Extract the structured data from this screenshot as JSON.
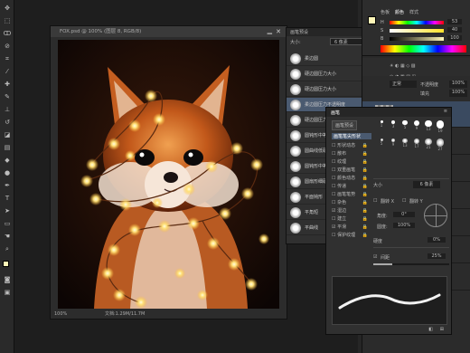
{
  "document": {
    "title": "FOX.psd @ 100% (图层 8, RGB/8)",
    "zoom": "100%",
    "doc_info": "文档:1.29M/11.7M"
  },
  "presets_panel": {
    "title": "画笔预设",
    "size_label": "大小:",
    "size_value": "6 像素",
    "items": [
      {
        "label": "柔边圆"
      },
      {
        "label": "硬边圆压力大小"
      },
      {
        "label": "硬边圆压力大小"
      },
      {
        "label": "柔边圆压力不透明度"
      },
      {
        "label": "硬边圆压力不透明度"
      },
      {
        "label": "圆钝形中等硬"
      },
      {
        "label": "圆曲线低硬毛刷百分比"
      },
      {
        "label": "圆钝形中等硬度"
      },
      {
        "label": "圆扇形细硬毛刷"
      },
      {
        "label": "平面钝形"
      },
      {
        "label": "平角短"
      },
      {
        "label": "平曲线"
      }
    ]
  },
  "brush_panel": {
    "title": "画笔",
    "preset_button": "画笔预设",
    "section_title": "画笔笔尖形状",
    "options": [
      {
        "label": "形状动态"
      },
      {
        "label": "散布"
      },
      {
        "label": "纹理"
      },
      {
        "label": "双重画笔"
      },
      {
        "label": "颜色动态"
      },
      {
        "label": "传递"
      },
      {
        "label": "画笔笔势"
      },
      {
        "label": "杂色"
      },
      {
        "label": "湿边"
      },
      {
        "label": "建立"
      },
      {
        "label": "平滑"
      },
      {
        "label": "保护纹理"
      }
    ],
    "tips": [
      {
        "num": "1"
      },
      {
        "num": "3"
      },
      {
        "num": "5"
      },
      {
        "num": "9"
      },
      {
        "num": "13"
      },
      {
        "num": "19"
      },
      {
        "num": "5"
      },
      {
        "num": "9"
      },
      {
        "num": "13"
      },
      {
        "num": "17"
      },
      {
        "num": "21"
      },
      {
        "num": "27"
      }
    ],
    "size_label": "大小",
    "size_value": "6 像素",
    "flipx_label": "翻转 X",
    "flipy_label": "翻转 Y",
    "angle_label": "角度:",
    "angle_value": "0°",
    "roundness_label": "圆度:",
    "roundness_value": "100%",
    "hardness_label": "硬度",
    "hardness_value": "0%",
    "spacing_label": "间距",
    "spacing_value": "25%"
  },
  "color_panel": {
    "tab_color": "颜色",
    "tab_swatches": "色板",
    "tab_styles": "样式",
    "h_label": "H",
    "h_value": "53",
    "s_label": "S",
    "s_value": "40",
    "b_label": "B",
    "b_value": "100"
  },
  "layers": {
    "blend_mode": "正常",
    "opacity_label": "不透明度",
    "opacity_value": "100%",
    "fill_label": "填充",
    "fill_value": "100%",
    "item_labels": [
      "图层 8",
      "图层 7",
      "图层 6",
      "图层 5",
      "图层 4",
      "图层 3",
      "图层 2"
    ]
  }
}
